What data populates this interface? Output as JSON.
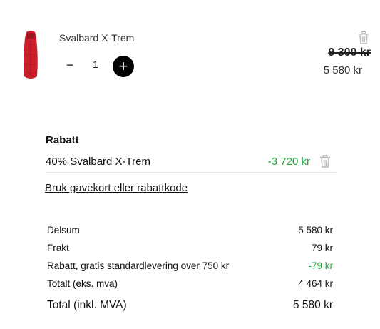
{
  "product": {
    "name": "Svalbard X-Trem",
    "quantity": "1",
    "minus_symbol": "−",
    "plus_symbol": "+",
    "price_original": "9 300 kr",
    "price_current": "5 580 kr",
    "image_icon": "red-sleeping-bag",
    "remove_icon": "trash-icon"
  },
  "discount": {
    "title": "Rabatt",
    "label": "40% Svalbard X-Trem",
    "amount": "-3 720 kr",
    "amount_color": "#22a83a",
    "remove_icon": "trash-icon"
  },
  "giftcard_link": "Bruk gavekort eller rabattkode",
  "summary": [
    {
      "label": "Delsum",
      "value": "5 580 kr"
    },
    {
      "label": "Frakt",
      "value": "79 kr"
    },
    {
      "label": "Rabatt, gratis standardlevering over 750 kr",
      "value": "-79 kr"
    },
    {
      "label": "Totalt (eks. mva)",
      "value": "4 464 kr"
    },
    {
      "label": "Total (inkl. MVA)",
      "value": "5 580 kr"
    }
  ],
  "colors": {
    "accent_green": "#22a83a",
    "product_red": "#cc1f2c"
  }
}
